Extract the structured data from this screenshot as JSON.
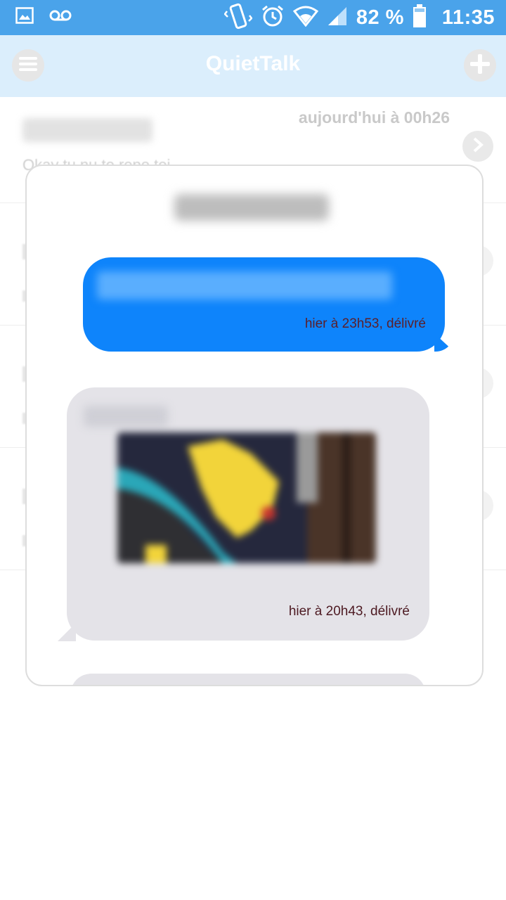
{
  "status_bar": {
    "battery_label": "82 %",
    "time": "11:35",
    "icons": [
      "gallery-icon",
      "voicemail-icon",
      "vibrate-icon",
      "alarm-icon",
      "wifi-icon",
      "signal-icon",
      "battery-icon"
    ]
  },
  "app_bar": {
    "title": "QuietTalk",
    "menu_icon": "hamburger-menu-icon",
    "add_icon": "plus-icon"
  },
  "conversation_list": {
    "first_item": {
      "timestamp": "aujourd'hui à 00h26",
      "preview": "Okay tu nu te repo toi"
    }
  },
  "modal": {
    "outgoing_message": {
      "meta": "hier à 23h53, délivré"
    },
    "incoming_message": {
      "meta": "hier à 20h43, délivré",
      "attachment": "image"
    }
  },
  "colors": {
    "status_bar": "#4aa3ea",
    "app_bar": "#dbeefc",
    "outgoing_bubble": "#0e84fb",
    "incoming_bubble": "#e4e3e8"
  }
}
